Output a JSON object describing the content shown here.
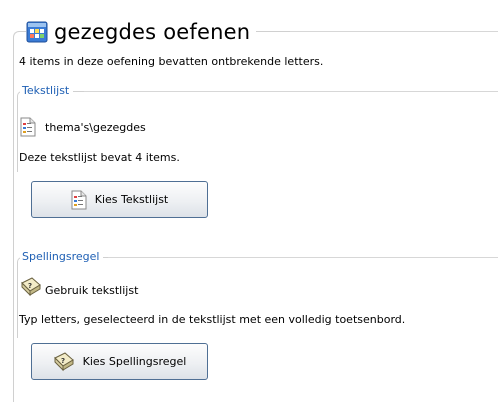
{
  "header": {
    "title": "gezegdes oefenen",
    "subtitle": "4 items in deze oefening bevatten ontbrekende letters."
  },
  "wordlist_group": {
    "title": "Tekstlijst",
    "file": "thema's\\gezegdes",
    "info": "Deze tekstlijst bevat 4 items.",
    "button_label": "Kies Tekstlijst"
  },
  "spelling_group": {
    "title": "Spellingsregel",
    "rule": "Gebruik tekstlijst",
    "description": "Typ letters, geselecteerd in de tekstlijst met een volledig toetsenbord.",
    "button_label": "Kies Spellingsregel"
  },
  "icons": {
    "app": "app-grid-icon",
    "wordlist": "text-list-icon",
    "rule": "question-book-icon"
  },
  "colors": {
    "group_title": "#1e5fb4",
    "button_border": "#4f6f94",
    "app_icon_blue": "#3a7bd5"
  }
}
